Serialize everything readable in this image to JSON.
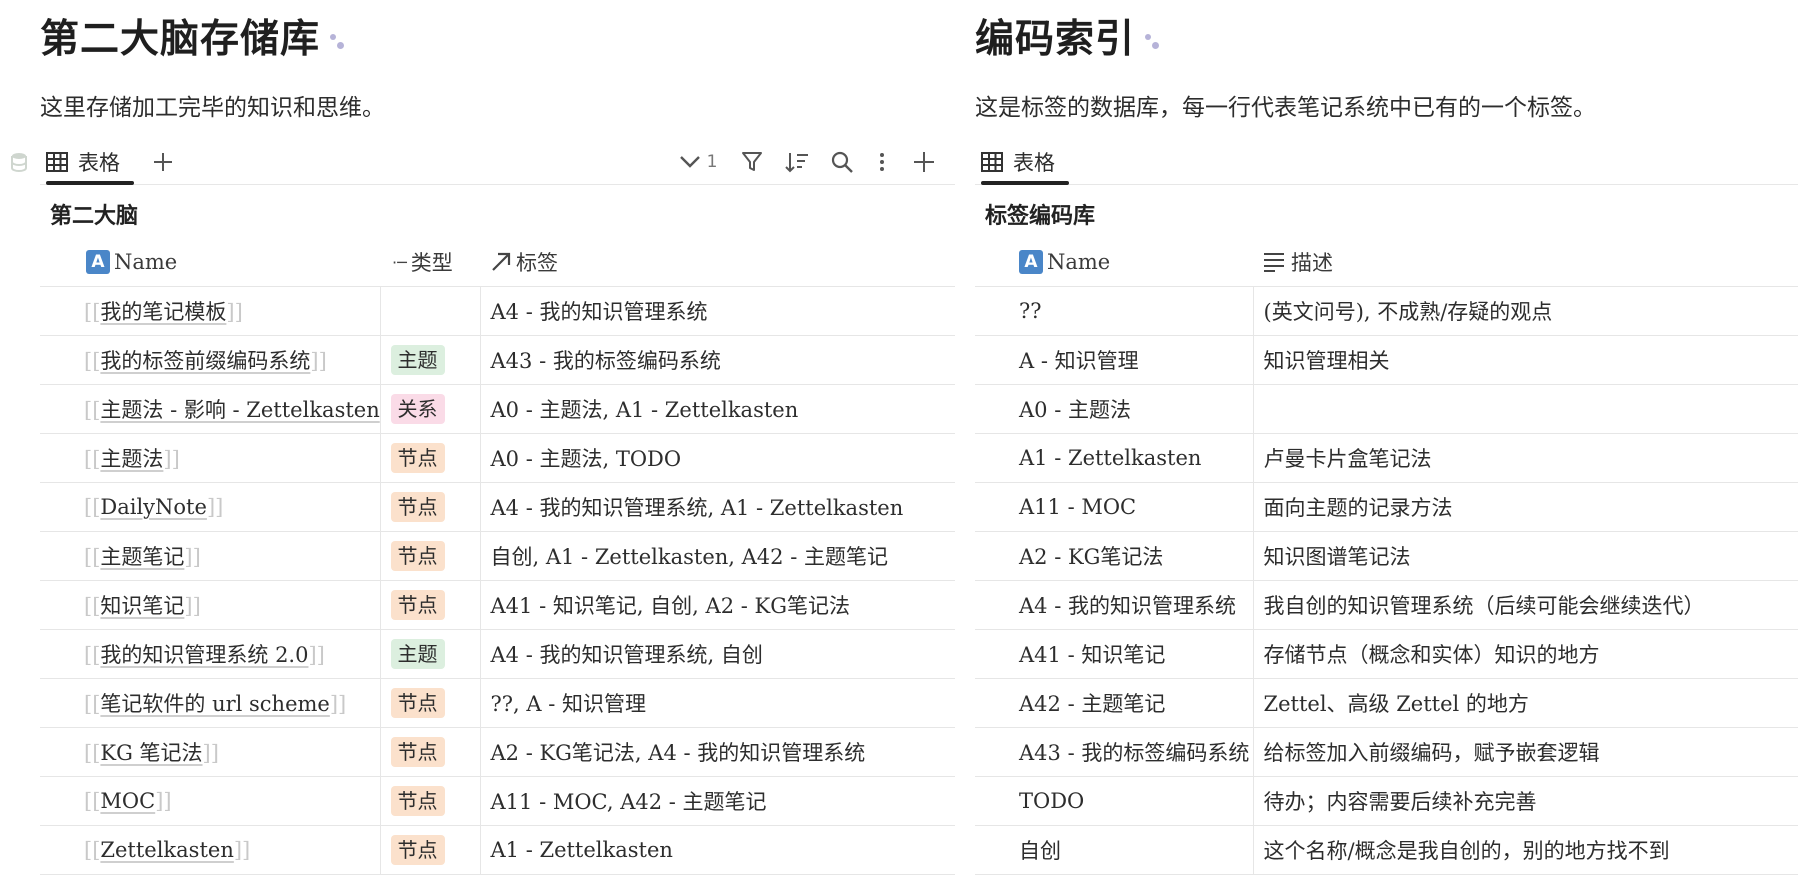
{
  "left": {
    "title": "第二大脑存储库",
    "description": "这里存储加工完毕的知识和思维。",
    "tab_label": "表格",
    "filter_count": "1",
    "db_name": "第二大脑",
    "columns": [
      "Name",
      "类型",
      "标签"
    ],
    "rows": [
      {
        "name": "我的笔记模板",
        "type": "",
        "tags": "A4 - 我的知识管理系统"
      },
      {
        "name": "我的标签前缀编码系统",
        "type": "主题",
        "tags": "A43 - 我的标签编码系统"
      },
      {
        "name": "主题法 - 影响 - Zettelkasten",
        "type": "关系",
        "tags": "A0 - 主题法, A1 - Zettelkasten"
      },
      {
        "name": "主题法",
        "type": "节点",
        "tags": "A0 - 主题法, TODO"
      },
      {
        "name": "DailyNote",
        "type": "节点",
        "tags": "A4 - 我的知识管理系统, A1 - Zettelkasten"
      },
      {
        "name": "主题笔记",
        "type": "节点",
        "tags": "自创, A1 - Zettelkasten, A42 - 主题笔记"
      },
      {
        "name": "知识笔记",
        "type": "节点",
        "tags": "A41 - 知识笔记, 自创, A2 - KG笔记法"
      },
      {
        "name": "我的知识管理系统 2.0",
        "type": "主题",
        "tags": "A4 - 我的知识管理系统, 自创"
      },
      {
        "name": "笔记软件的 url scheme",
        "type": "节点",
        "tags": "??, A - 知识管理"
      },
      {
        "name": "KG 笔记法",
        "type": "节点",
        "tags": "A2 - KG笔记法, A4 - 我的知识管理系统"
      },
      {
        "name": "MOC",
        "type": "节点",
        "tags": "A11 - MOC, A42 - 主题笔记"
      },
      {
        "name": "Zettelkasten",
        "type": "节点",
        "tags": "A1 - Zettelkasten"
      }
    ],
    "type_colors": {
      "主题": "#dcefdf",
      "关系": "#fadbe7",
      "节点": "#fbe1cc"
    }
  },
  "right": {
    "title": "编码索引",
    "description": "这是标签的数据库，每一行代表笔记系统中已有的一个标签。",
    "tab_label": "表格",
    "db_name": "标签编码库",
    "columns": [
      "Name",
      "描述"
    ],
    "rows": [
      {
        "name": "??",
        "desc": "(英文问号), 不成熟/存疑的观点"
      },
      {
        "name": "A - 知识管理",
        "desc": "知识管理相关"
      },
      {
        "name": "A0 - 主题法",
        "desc": ""
      },
      {
        "name": "A1 - Zettelkasten",
        "desc": "卢曼卡片盒笔记法"
      },
      {
        "name": "A11 - MOC",
        "desc": "面向主题的记录方法"
      },
      {
        "name": "A2 - KG笔记法",
        "desc": "知识图谱笔记法"
      },
      {
        "name": "A4 - 我的知识管理系统",
        "desc": "我自创的知识管理系统（后续可能会继续迭代）"
      },
      {
        "name": "A41 - 知识笔记",
        "desc": "存储节点（概念和实体）知识的地方"
      },
      {
        "name": "A42 - 主题笔记",
        "desc": "Zettel、高级 Zettel 的地方"
      },
      {
        "name": "A43 - 我的标签编码系统",
        "desc": "给标签加入前缀编码，赋予嵌套逻辑"
      },
      {
        "name": "TODO",
        "desc": "待办；内容需要后续补充完善"
      },
      {
        "name": "自创",
        "desc": "这个名称/概念是我自创的，别的地方找不到"
      }
    ]
  }
}
